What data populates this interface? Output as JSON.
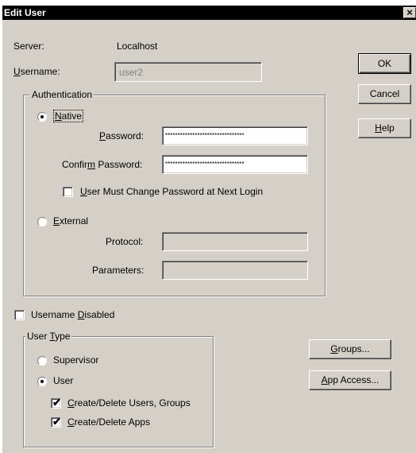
{
  "window": {
    "title": "Edit User",
    "close_glyph": "×"
  },
  "server": {
    "label": "Server:",
    "value": "Localhost"
  },
  "username": {
    "label_pre": "",
    "label_u": "U",
    "label_post": "sername:",
    "value": "user2"
  },
  "buttons": {
    "ok": "OK",
    "cancel": "Cancel",
    "help_u": "H",
    "help_post": "elp",
    "groups_u": "G",
    "groups_post": "roups...",
    "app_access_pre": "",
    "app_access_u": "A",
    "app_access_post": "pp Access..."
  },
  "authentication": {
    "title": "Authentication",
    "native": {
      "label_u": "N",
      "label_post": "ative",
      "selected": true
    },
    "password": {
      "label_u": "P",
      "label_post": "assword:",
      "value": "********************************"
    },
    "confirm": {
      "label_pre": "Confir",
      "label_u": "m",
      "label_post": " Password:",
      "value": "********************************"
    },
    "must_change": {
      "label_pre": "",
      "label_u": "U",
      "label_post": "ser Must Change Password at Next Login",
      "checked": false
    },
    "external": {
      "label_u": "E",
      "label_post": "xternal",
      "selected": false
    },
    "protocol": {
      "label": "Protocol:",
      "value": ""
    },
    "parameters": {
      "label": "Parameters:",
      "value": ""
    }
  },
  "username_disabled": {
    "label_pre": "Username ",
    "label_u": "D",
    "label_post": "isabled",
    "checked": false
  },
  "user_type": {
    "title_pre": "User ",
    "title_u": "T",
    "title_post": "ype",
    "supervisor": {
      "label": "Supervisor",
      "selected": false
    },
    "user": {
      "label": "User",
      "selected": true
    },
    "create_users": {
      "label_u": "C",
      "label_post": "reate/Delete Users, Groups",
      "checked": true
    },
    "create_apps": {
      "label_u": "C",
      "label_post": "reate/Delete Apps",
      "checked": true
    }
  },
  "glyphs": {
    "check": "✔"
  }
}
